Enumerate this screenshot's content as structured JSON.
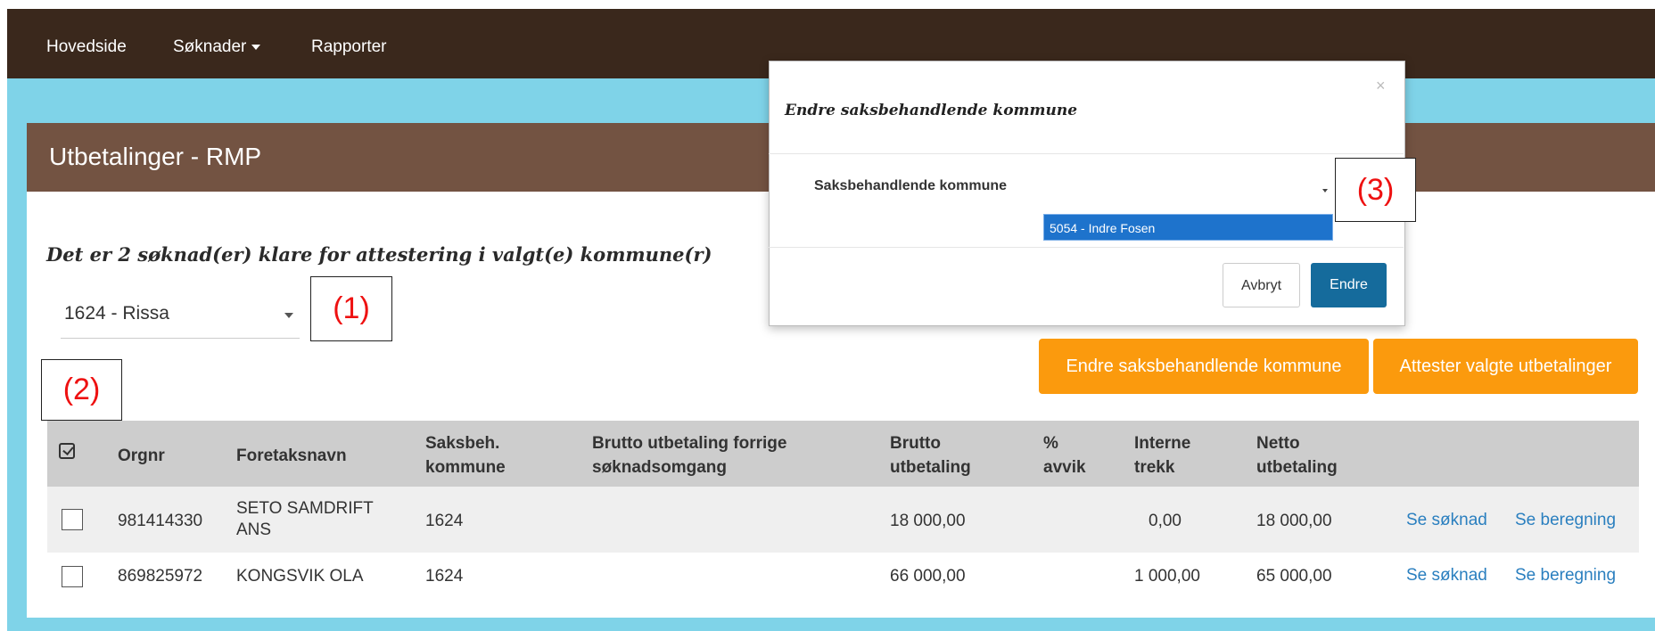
{
  "nav": {
    "home": "Hovedside",
    "applications": "Søknader",
    "reports": "Rapporter"
  },
  "panel": {
    "title": "Utbetalinger - RMP",
    "info": "Det er 2 søknad(er) klare for attestering i valgt(e) kommune(r)",
    "municipality_select": "1624 - Rissa"
  },
  "callouts": {
    "one": "(1)",
    "two": "(2)",
    "three": "(3)"
  },
  "actions": {
    "change_municipality": "Endre saksbehandlende kommune",
    "attest_selected": "Attester valgte utbetalinger"
  },
  "table": {
    "headers": {
      "orgnr": "Orgnr",
      "name": "Foretaksnavn",
      "case_muni_1": "Saksbeh.",
      "case_muni_2": "kommune",
      "prev_gross_1": "Brutto utbetaling forrige",
      "prev_gross_2": "søknadsomgang",
      "gross_1": "Brutto",
      "gross_2": "utbetaling",
      "dev_1": "%",
      "dev_2": "avvik",
      "internal_1": "Interne",
      "internal_2": "trekk",
      "net_1": "Netto",
      "net_2": "utbetaling"
    },
    "rows": [
      {
        "orgnr": "981414330",
        "name_1": "SETO SAMDRIFT",
        "name_2": "ANS",
        "case_muni": "1624",
        "prev_gross": "",
        "gross": "18 000,00",
        "deviation": "",
        "internal": "0,00",
        "net": "18 000,00",
        "see_application": "Se søknad",
        "see_calculation": "Se beregning"
      },
      {
        "orgnr": "869825972",
        "name_1": "KONGSVIK OLA",
        "name_2": "",
        "case_muni": "1624",
        "prev_gross": "",
        "gross": "66 000,00",
        "deviation": "",
        "internal": "1 000,00",
        "net": "65 000,00",
        "see_application": "Se søknad",
        "see_calculation": "Se beregning"
      }
    ]
  },
  "modal": {
    "close": "×",
    "title": "Endre saksbehandlende kommune",
    "label": "Saksbehandlende kommune",
    "selected_option": "5054 - Indre Fosen",
    "cancel": "Avbryt",
    "submit": "Endre"
  },
  "colors": {
    "navbar": "#3a281c",
    "panel_header": "#735342",
    "background": "#7fd3e8",
    "orange": "#fb9a0d",
    "primary": "#156b9c",
    "link": "#2a7fbf"
  }
}
